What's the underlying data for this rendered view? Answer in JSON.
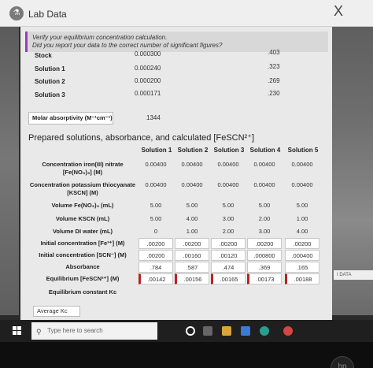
{
  "dialog": {
    "title": "Lab Data",
    "close_glyph": "X"
  },
  "tip": {
    "line1": "Verify your equilibrium concentration calculation.",
    "line2": "Did you report your data to the correct number of significant figures?"
  },
  "stock": {
    "label": "Stock",
    "value": "0.000300",
    "abs": ".403"
  },
  "solutions": [
    {
      "label": "Solution 1",
      "value": "0.000240",
      "abs": ".323"
    },
    {
      "label": "Solution 2",
      "value": "0.000200",
      "abs": ".269"
    },
    {
      "label": "Solution 3",
      "value": "0.000171",
      "abs": ".230"
    }
  ],
  "molar": {
    "label": "Molar absorptivity (M⁻¹cm⁻¹)",
    "value": "1344"
  },
  "section_title": "Prepared solutions, absorbance, and calculated [FeSCN²⁺]",
  "table": {
    "headers": [
      "Solution 1",
      "Solution 2",
      "Solution 3",
      "Solution 4",
      "Solution 5"
    ],
    "rows": [
      {
        "label": "Concentration iron(III) nitrate [Fe(NO₃)₃] (M)",
        "values": [
          "0.00400",
          "0.00400",
          "0.00400",
          "0.00400",
          "0.00400"
        ],
        "boxed": false
      },
      {
        "label": "Concentration potassium thiocyanate [KSCN] (M)",
        "values": [
          "0.00400",
          "0.00400",
          "0.00400",
          "0.00400",
          "0.00400"
        ],
        "boxed": false
      },
      {
        "label": "Volume Fe(NO₃)₃ (mL)",
        "values": [
          "5.00",
          "5.00",
          "5.00",
          "5.00",
          "5.00"
        ],
        "boxed": false
      },
      {
        "label": "Volume KSCN (mL)",
        "values": [
          "5.00",
          "4.00",
          "3.00",
          "2.00",
          "1.00"
        ],
        "boxed": false
      },
      {
        "label": "Volume DI water (mL)",
        "values": [
          "0",
          "1.00",
          "2.00",
          "3.00",
          "4.00"
        ],
        "boxed": false
      },
      {
        "label": "Initial concentration [Fe³⁺] (M)",
        "values": [
          ".00200",
          ".00200",
          ".00200",
          ".00200",
          ".00200"
        ],
        "boxed": true
      },
      {
        "label": "Initial concentration [SCN⁻] (M)",
        "values": ".00200|.00160|.00120|.000800|.000400",
        "boxed": true
      },
      {
        "label": "Absorbance",
        "values": [
          ".784",
          ".587",
          ".474",
          ".369",
          ".165"
        ],
        "boxed": true
      },
      {
        "label": "Equilibrium [FeSCN²⁺] (M)",
        "values": [
          ".00142",
          ".00156",
          ".00165",
          ".00173",
          ".00188"
        ],
        "boxed": true,
        "error": true
      },
      {
        "label": "Equilibrium constant Kc",
        "values": [
          "",
          "",
          "",
          "",
          ""
        ],
        "boxed": false
      }
    ]
  },
  "average": {
    "label": "Average Kc"
  },
  "side_tab": {
    "label": "I DATA"
  },
  "taskbar": {
    "search_placeholder": "Type here to search"
  },
  "logo": {
    "text": "hp"
  }
}
